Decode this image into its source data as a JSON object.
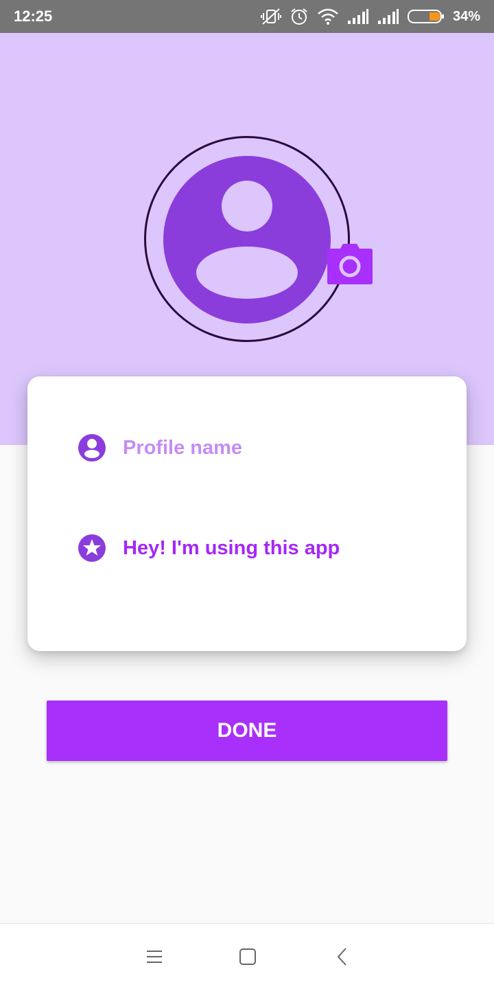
{
  "status_bar": {
    "time": "12:25",
    "battery_percent": "34%",
    "icons": [
      "vibrate-off-icon",
      "alarm-icon",
      "wifi-icon",
      "signal-icon",
      "signal-icon",
      "battery-icon"
    ],
    "battery_color": "#f7941d"
  },
  "profile": {
    "avatar_icon": "person-placeholder-icon",
    "camera_icon": "camera-icon",
    "name_placeholder": "Profile name",
    "status_text": "Hey! I'm using this app"
  },
  "actions": {
    "done_label": "DONE"
  },
  "nav_bar": {
    "icons": [
      "menu-icon",
      "home-icon",
      "back-icon"
    ]
  },
  "colors": {
    "header_background": "#dcc6fc",
    "accent": "#a92ffa",
    "icon_purple": "#8a3ddb",
    "placeholder_text": "#c58cf6"
  }
}
